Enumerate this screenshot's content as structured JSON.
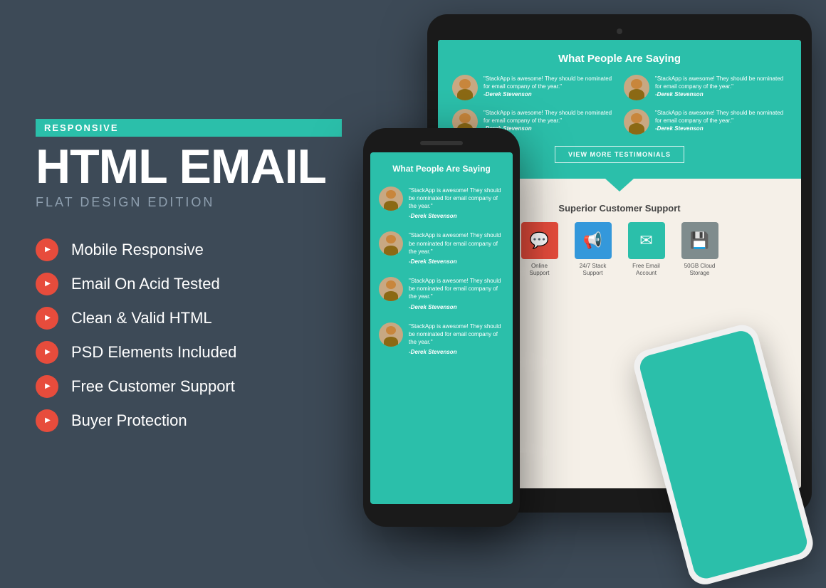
{
  "badge": "RESPONSIVE",
  "main_title": "HTML EMAIL",
  "sub_title": "FLAT DESIGN EDITION",
  "features": [
    {
      "id": "mobile-responsive",
      "label": "Mobile Responsive"
    },
    {
      "id": "email-acid-tested",
      "label": "Email On Acid Tested"
    },
    {
      "id": "clean-valid-html",
      "label": "Clean & Valid HTML"
    },
    {
      "id": "psd-elements",
      "label": "PSD Elements Included"
    },
    {
      "id": "free-support",
      "label": "Free Customer Support"
    },
    {
      "id": "buyer-protection",
      "label": "Buyer Protection"
    }
  ],
  "tablet": {
    "testimonials_title": "What People Are Saying",
    "testimonials": [
      {
        "quote": "\"StackApp is awesome! They should be nominated for email company of the year.\"",
        "author": "-Derek Stevenson"
      },
      {
        "quote": "\"StackApp is awesome! They should be nominated for email company of the year.\"",
        "author": "-Derek Stevenson"
      },
      {
        "quote": "\"StackApp is awesome! They should be nominated for email company of the year.\"",
        "author": "-Derek Stevenson"
      },
      {
        "quote": "\"StackApp is awesome! They should be nominated for email company of the year.\"",
        "author": "-Derek Stevenson"
      }
    ],
    "view_more_btn": "VIEW MORE TESTIMONIALS",
    "support_title": "Superior Customer Support",
    "support_items": [
      {
        "id": "online-support",
        "icon": "💬",
        "label": "Online\nSupport",
        "color": "icon-red"
      },
      {
        "id": "24-7-support",
        "icon": "📢",
        "label": "24/7 Stack\nSupport",
        "color": "icon-blue"
      },
      {
        "id": "email-account",
        "icon": "✉",
        "label": "Free Email\nAccount",
        "color": "icon-teal"
      },
      {
        "id": "cloud-storage",
        "icon": "💾",
        "label": "50GB Cloud\nStorage",
        "color": "icon-gray"
      }
    ]
  },
  "phone": {
    "title": "What People Are Saying",
    "testimonials": [
      {
        "quote": "\"StackApp is awesome! They should be nominated for email company of the year.\"",
        "author": "-Derek Stevenson"
      },
      {
        "quote": "\"StackApp is awesome! They should be nominated for email company of the year.\"",
        "author": "-Derek Stevenson"
      },
      {
        "quote": "\"StackApp is awesome! They should be nominated for email company of the year.\"",
        "author": "-Derek Stevenson"
      },
      {
        "quote": "\"StackApp is awesome! They should be nominated for email company of the year.\"",
        "author": "-Derek Stevenson"
      }
    ]
  }
}
